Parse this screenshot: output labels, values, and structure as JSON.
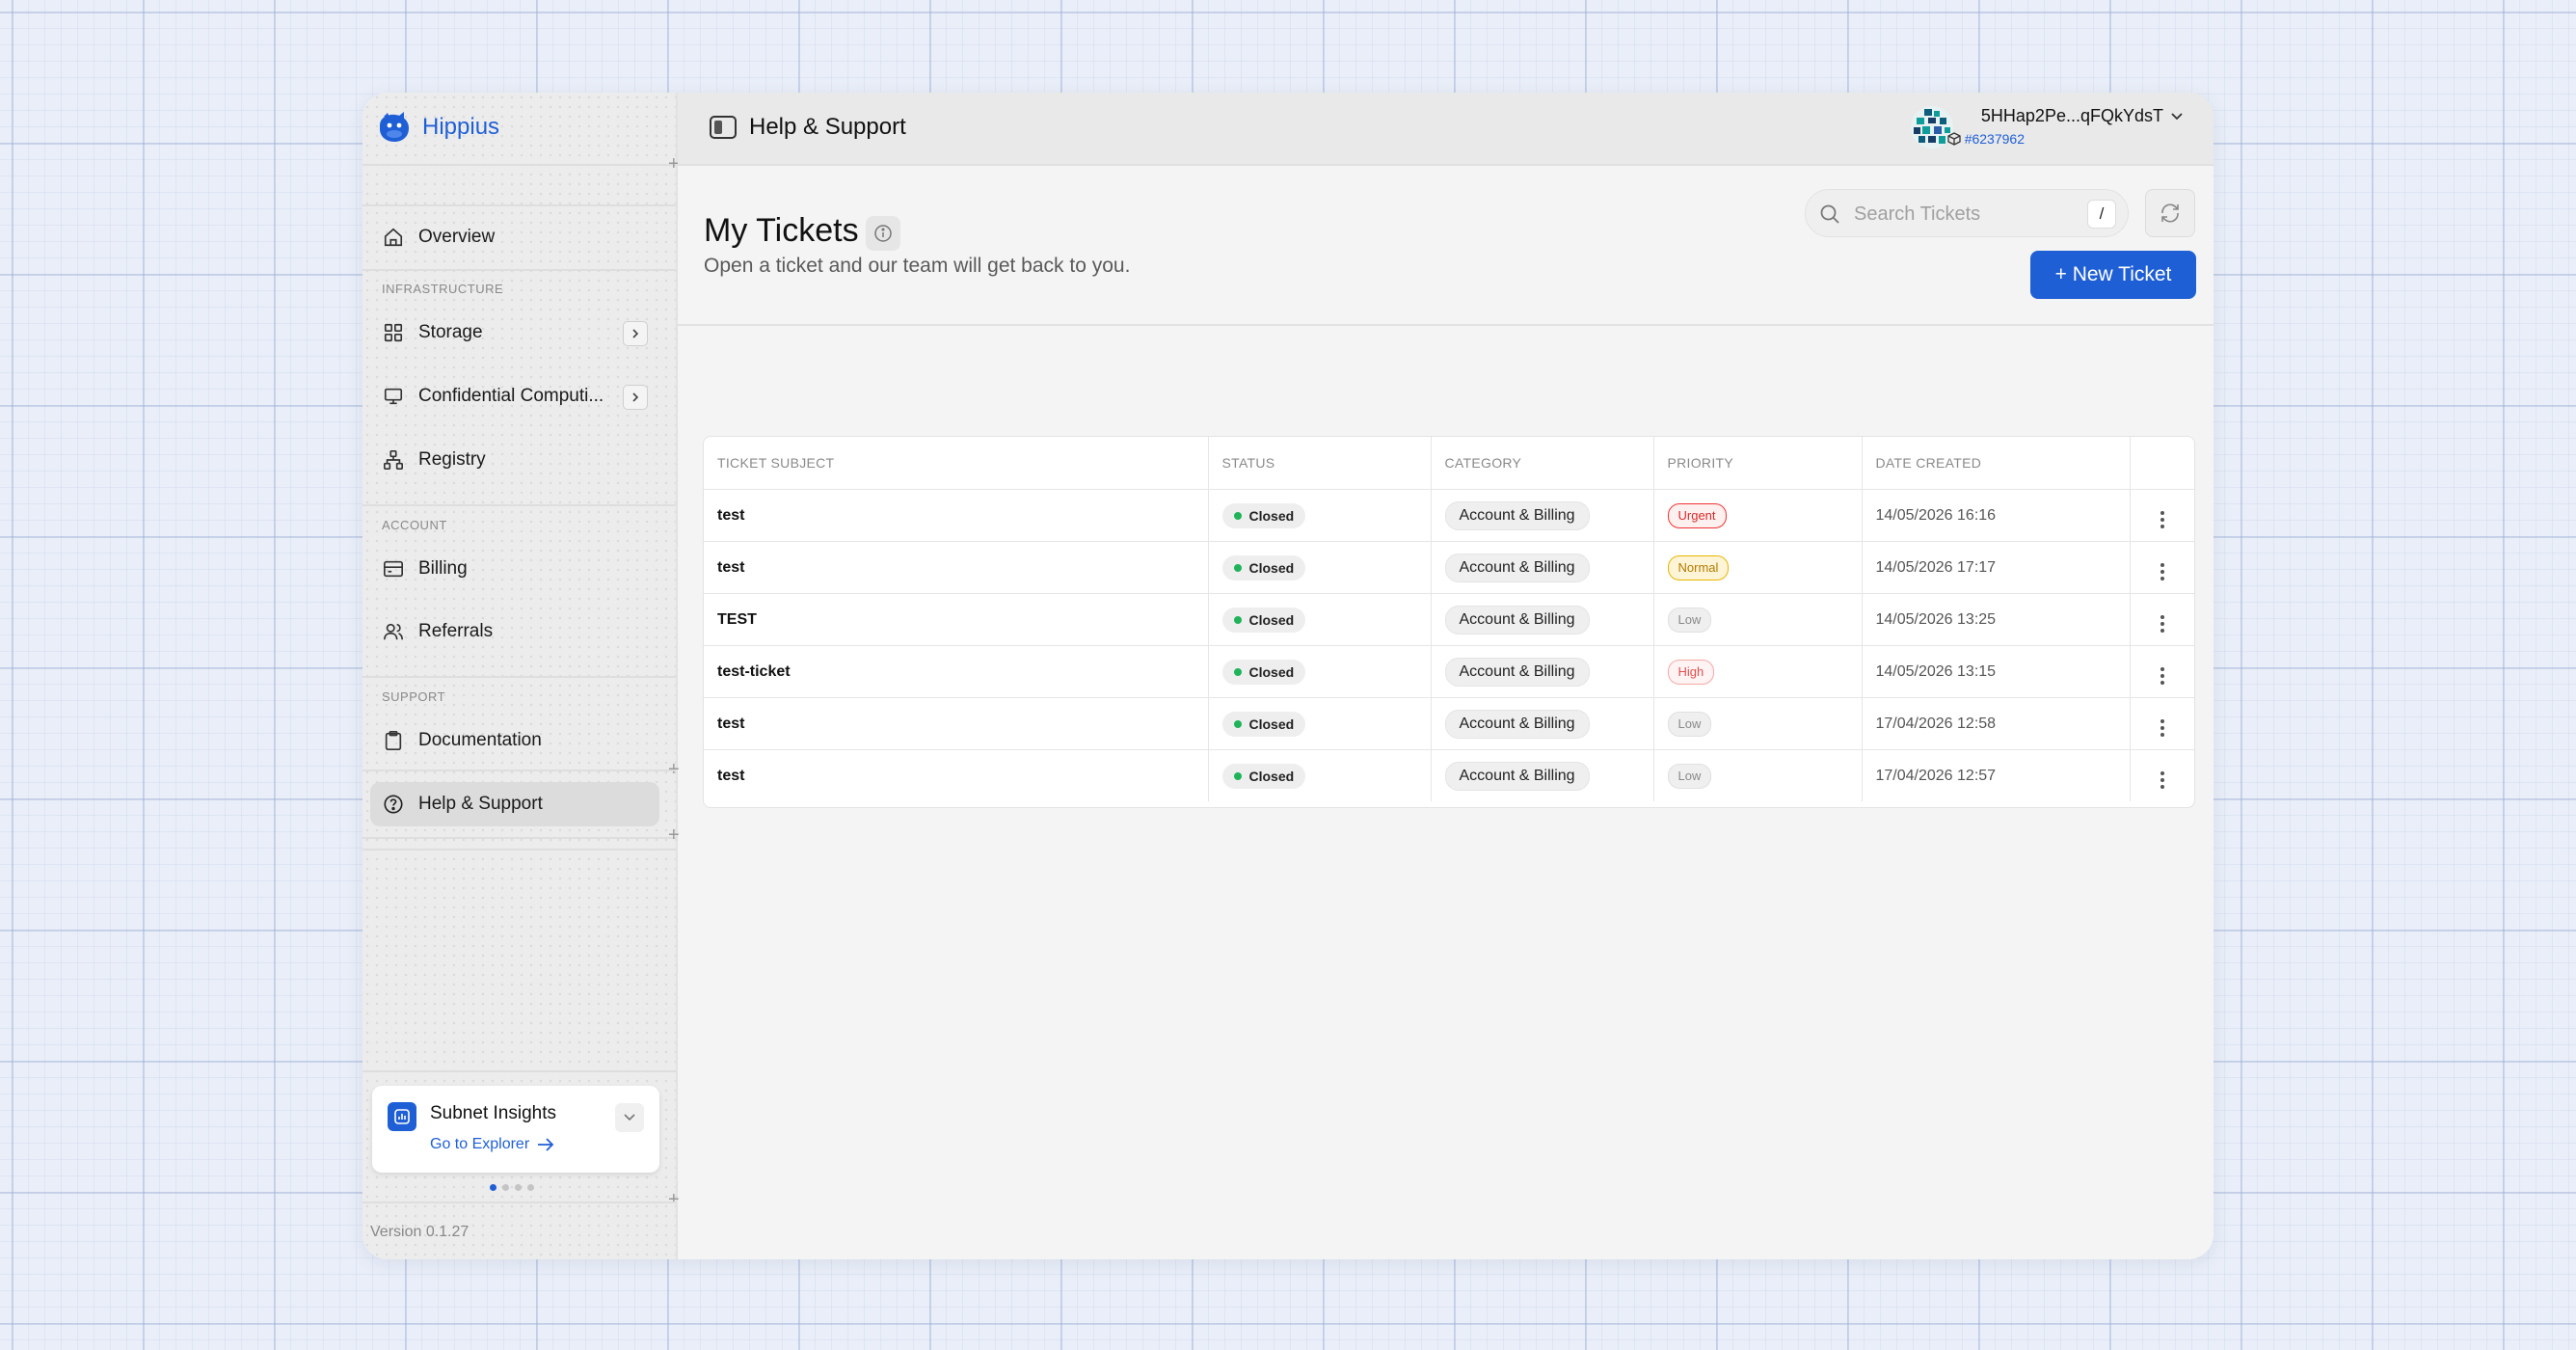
{
  "app": {
    "brand": "Hippius",
    "version": "Version 0.1.27"
  },
  "topbar": {
    "title": "Help & Support",
    "account_name": "5HHap2Pe...qFQkYdsT",
    "account_id": "#6237962"
  },
  "sidebar": {
    "overview": "Overview",
    "sections": {
      "infrastructure": "INFRASTRUCTURE",
      "account": "ACCOUNT",
      "support": "SUPPORT"
    },
    "items": {
      "storage": "Storage",
      "confidential": "Confidential Computi...",
      "registry": "Registry",
      "billing": "Billing",
      "referrals": "Referrals",
      "documentation": "Documentation",
      "help": "Help & Support"
    },
    "insights": {
      "title": "Subnet Insights",
      "link": "Go to Explorer"
    }
  },
  "main": {
    "title": "My Tickets",
    "subtitle": "Open a ticket and our team will get back to you.",
    "search_placeholder": "Search Tickets",
    "search_shortcut": "/",
    "new_ticket": "+ New Ticket"
  },
  "table": {
    "columns": [
      "TICKET SUBJECT",
      "STATUS",
      "CATEGORY",
      "PRIORITY",
      "DATE CREATED"
    ],
    "rows": [
      {
        "subject": "test",
        "status": "Closed",
        "category": "Account & Billing",
        "priority": "Urgent",
        "date": "14/05/2026 16:16"
      },
      {
        "subject": "test",
        "status": "Closed",
        "category": "Account & Billing",
        "priority": "Normal",
        "date": "14/05/2026 17:17"
      },
      {
        "subject": "TEST",
        "status": "Closed",
        "category": "Account & Billing",
        "priority": "Low",
        "date": "14/05/2026 13:25"
      },
      {
        "subject": "test-ticket",
        "status": "Closed",
        "category": "Account & Billing",
        "priority": "High",
        "date": "14/05/2026 13:15"
      },
      {
        "subject": "test",
        "status": "Closed",
        "category": "Account & Billing",
        "priority": "Low",
        "date": "17/04/2026 12:58"
      },
      {
        "subject": "test",
        "status": "Closed",
        "category": "Account & Billing",
        "priority": "Low",
        "date": "17/04/2026 12:57"
      }
    ]
  },
  "colors": {
    "accent": "#1f5fd6",
    "status_closed": "#1fb45a"
  }
}
